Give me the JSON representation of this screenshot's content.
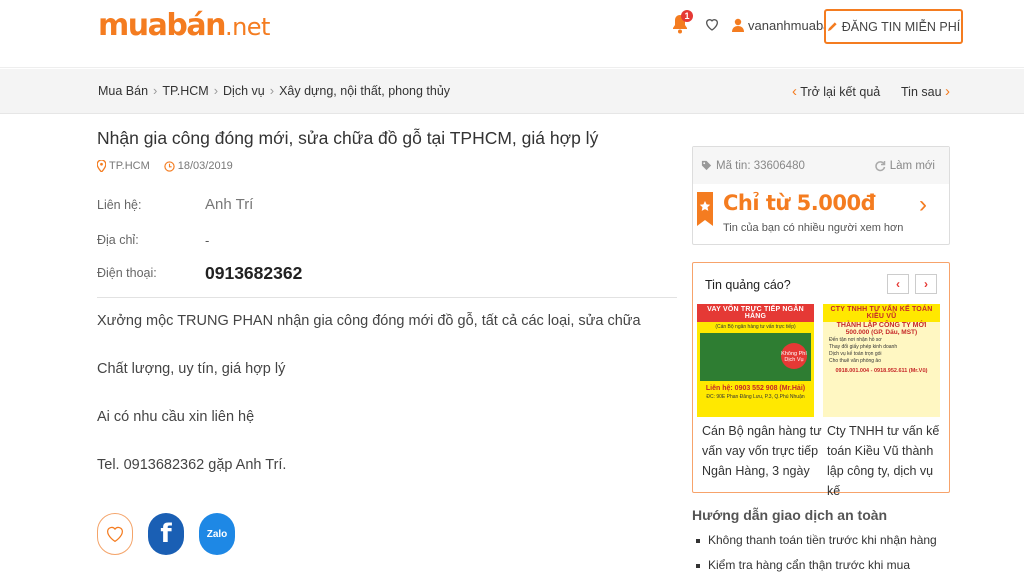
{
  "header": {
    "logo_main": "muabán",
    "logo_suffix": ".net",
    "notification_count": "1",
    "username": "vananhmuaban",
    "post_button": "ĐĂNG TIN MIỄN PHÍ"
  },
  "breadcrumb": {
    "items": [
      "Mua Bán",
      "TP.HCM",
      "Dịch vụ",
      "Xây dựng, nội thất, phong thủy"
    ],
    "back_label": "Trở lại kết quả",
    "next_label": "Tin sau"
  },
  "listing": {
    "title": "Nhận gia công đóng mới, sửa chữa đồ gỗ tại TPHCM, giá hợp lý",
    "location": "TP.HCM",
    "date": "18/03/2019",
    "contact_label": "Liên hệ:",
    "contact_value": "Anh Trí",
    "address_label": "Địa chỉ:",
    "address_value": "-",
    "phone_label": "Điện thoại:",
    "phone_value": "0913682362",
    "description": [
      "Xưởng mộc TRUNG PHAN nhận gia công đóng mới đồ gỗ, tất cả các loại, sửa chữa",
      "Chất lượng, uy tín, giá hợp lý",
      "Ai có nhu cầu xin liên hệ",
      "Tel. 0913682362 gặp Anh Trí."
    ],
    "share": {
      "facebook": "f",
      "zalo": "Zalo"
    }
  },
  "boost": {
    "code_label": "Mã tin: 33606480",
    "refresh_label": "Làm mới",
    "price_text": "Chỉ từ 5.000đ",
    "sub_text": "Tin của bạn có nhiều người xem hơn"
  },
  "ads": {
    "heading": "Tin quảng cáo?",
    "prev": "‹",
    "next": "›",
    "items": [
      {
        "banner_title": "VAY VỐN TRỰC TIẾP NGÂN HÀNG",
        "banner_sub": "(Cán Bộ ngân hàng tư vấn trực tiếp)",
        "banner_badge": "Không Phí Dịch Vụ",
        "banner_phone": "Liên hệ: 0903 552 908 (Mr.Hải)",
        "banner_addr": "ĐC: 90E Phan Đăng Lưu, P.3, Q.Phú Nhuận",
        "caption": "Cán Bộ ngân hàng tư vấn vay vốn trực tiếp Ngân Hàng, 3 ngày"
      },
      {
        "banner_title": "CTY TNHH TƯ VẤN KẾ TOÁN KIỀU VŨ",
        "banner_sub": "THÀNH LẬP CÔNG TY MỚI",
        "banner_price": "500.000 (GP, Dấu, MST)",
        "banner_lines": [
          "Đến tận nơi nhận hồ sơ",
          "Thay đổi giấy phép kinh doanh",
          "Dịch vụ kế toán trọn gói",
          "Cho thuê văn phòng ảo"
        ],
        "banner_phone": "0918.001.004 - 0918.952.611 (Mr.Vũ)",
        "caption": "Cty TNHH tư vấn kế toán Kiều Vũ thành lập công ty, dịch vụ kế"
      }
    ]
  },
  "guide": {
    "title": "Hướng dẫn giao dịch an toàn",
    "items": [
      "Không thanh toán tiền trước khi nhận hàng",
      "Kiểm tra hàng cẩn thận trước khi mua"
    ]
  },
  "colors": {
    "brand": "#f47c20",
    "facebook": "#1a5fb4",
    "zalo": "#1e88e5",
    "badge": "#e53935"
  }
}
